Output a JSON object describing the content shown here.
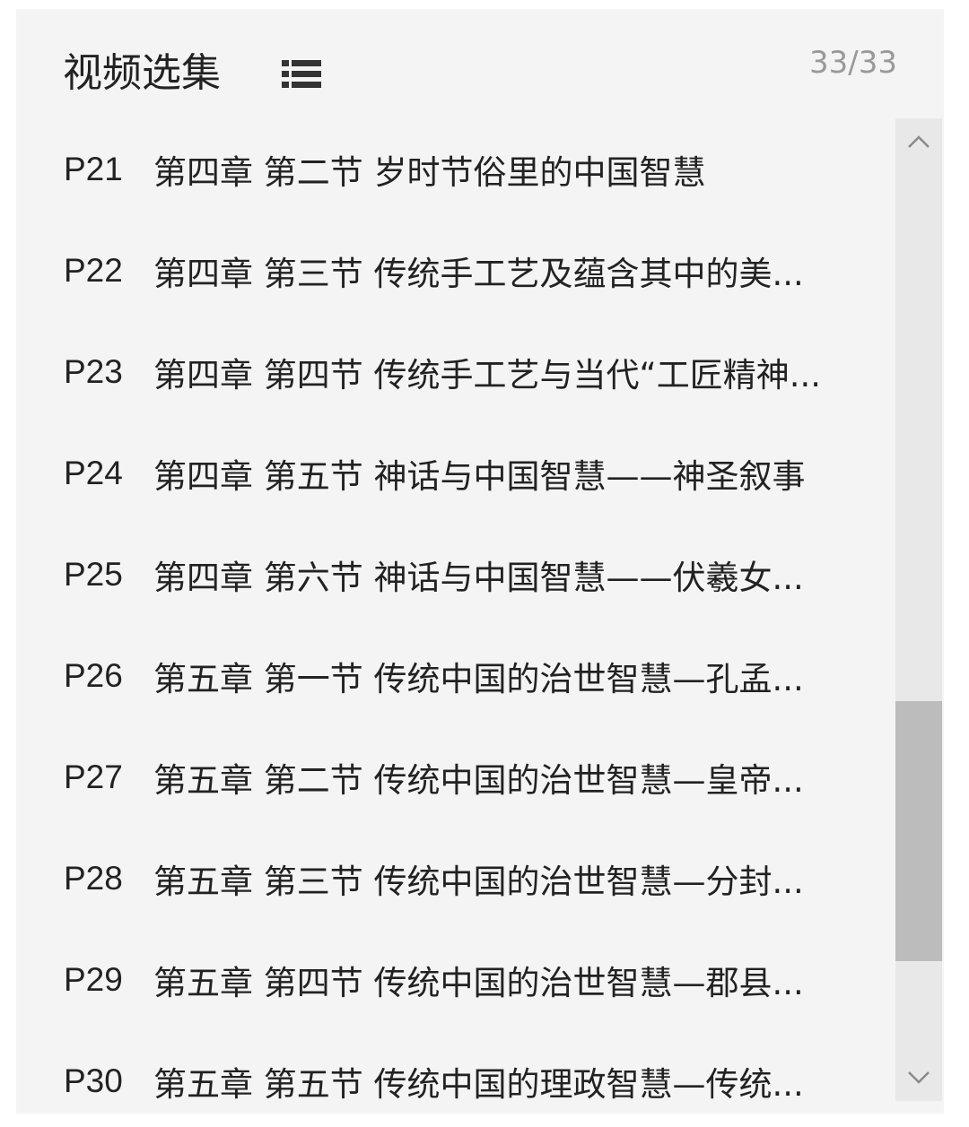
{
  "header": {
    "title": "视频选集",
    "counter": "33/33",
    "list_icon": "list-icon"
  },
  "episodes": [
    {
      "num": "P21",
      "title": "第四章 第二节 岁时节俗里的中国智慧"
    },
    {
      "num": "P22",
      "title": "第四章 第三节 传统手工艺及蕴含其中的美..."
    },
    {
      "num": "P23",
      "title": "第四章 第四节 传统手工艺与当代“工匠精神..."
    },
    {
      "num": "P24",
      "title": "第四章 第五节 神话与中国智慧——神圣叙事"
    },
    {
      "num": "P25",
      "title": "第四章 第六节 神话与中国智慧——伏羲女..."
    },
    {
      "num": "P26",
      "title": "第五章 第一节 传统中国的治世智慧—孔孟..."
    },
    {
      "num": "P27",
      "title": "第五章 第二节 传统中国的治世智慧—皇帝..."
    },
    {
      "num": "P28",
      "title": "第五章 第三节 传统中国的治世智慧—分封..."
    },
    {
      "num": "P29",
      "title": "第五章 第四节 传统中国的治世智慧—郡县..."
    },
    {
      "num": "P30",
      "title": "第五章 第五节 传统中国的理政智慧—传统..."
    }
  ],
  "scrollbar": {
    "up_icon": "chevron-up-icon",
    "down_icon": "chevron-down-icon"
  },
  "colors": {
    "panel_bg": "#f4f4f4",
    "text": "#222222",
    "counter": "#999999",
    "track": "#e8e8e8",
    "thumb": "#bcbcbc"
  }
}
